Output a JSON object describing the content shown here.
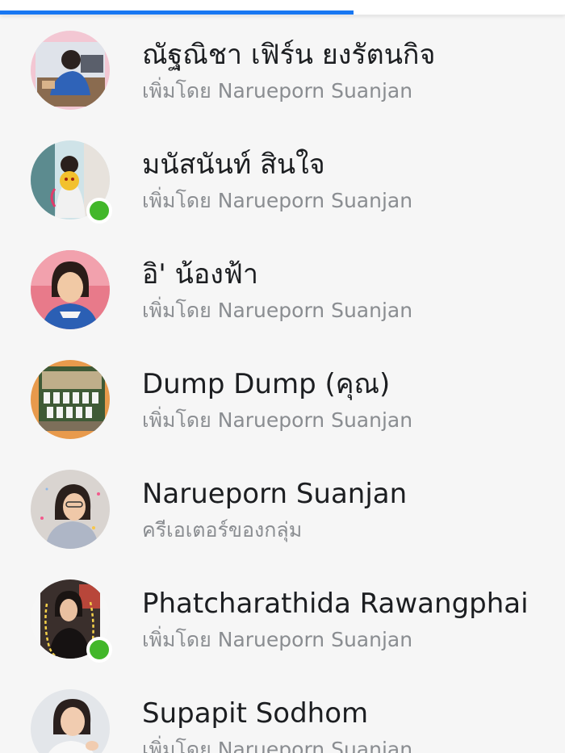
{
  "progress": {
    "fraction": 0.625,
    "color": "#1877f2"
  },
  "presence_color": "#42b72a",
  "members": [
    {
      "name": "ณัฐณิชา เฟิร์น ยงรัตนกิจ",
      "subtitle": "เพิ่มโดย Narueporn Suanjan",
      "online": false
    },
    {
      "name": "มนัสนันท์ สินใจ",
      "subtitle": "เพิ่มโดย Narueporn Suanjan",
      "online": true
    },
    {
      "name": "อิ' น้องฟ้า",
      "subtitle": "เพิ่มโดย Narueporn Suanjan",
      "online": false
    },
    {
      "name": "Dump Dump (คุณ)",
      "subtitle": "เพิ่มโดย Narueporn Suanjan",
      "online": false
    },
    {
      "name": "Narueporn Suanjan",
      "subtitle": "ครีเอเตอร์ของกลุ่ม",
      "online": false
    },
    {
      "name": "Phatcharathida Rawangphai",
      "subtitle": "เพิ่มโดย Narueporn Suanjan",
      "online": true
    },
    {
      "name": "Supapit Sodhom",
      "subtitle": "เพิ่มโดย Narueporn Suanjan",
      "online": false
    }
  ]
}
